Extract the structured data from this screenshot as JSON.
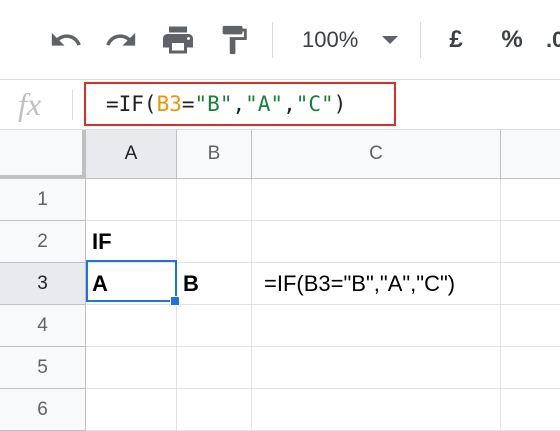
{
  "toolbar": {
    "buttons": [
      {
        "name": "undo-icon",
        "label": "Undo"
      },
      {
        "name": "redo-icon",
        "label": "Redo"
      },
      {
        "name": "print-icon",
        "label": "Print"
      },
      {
        "name": "paint-format-icon",
        "label": "Paint format"
      }
    ],
    "zoom": "100%",
    "currency": "£",
    "percent": "%"
  },
  "formula_bar": {
    "fx": "fx",
    "formula_parts": [
      {
        "text": "=IF(",
        "kind": "plain"
      },
      {
        "text": "B3",
        "kind": "ref"
      },
      {
        "text": "=",
        "kind": "plain"
      },
      {
        "text": "\"B\"",
        "kind": "str"
      },
      {
        "text": ",",
        "kind": "plain"
      },
      {
        "text": "\"A\"",
        "kind": "str"
      },
      {
        "text": ",",
        "kind": "plain"
      },
      {
        "text": "\"C\"",
        "kind": "str"
      },
      {
        "text": ")",
        "kind": "plain"
      }
    ]
  },
  "grid": {
    "columns": [
      "A",
      "B",
      "C"
    ],
    "rows": [
      "1",
      "2",
      "3",
      "4",
      "5",
      "6"
    ],
    "active_cell": "A3",
    "cells": {
      "A2": "IF",
      "A3": "A",
      "B3": "B",
      "C3": "=IF(B3=\"B\",\"A\",\"C\")"
    }
  },
  "colors": {
    "highlight_border": "#d93025",
    "selection": "#1a73e8",
    "reference": "#f09300",
    "string": "#188038"
  }
}
